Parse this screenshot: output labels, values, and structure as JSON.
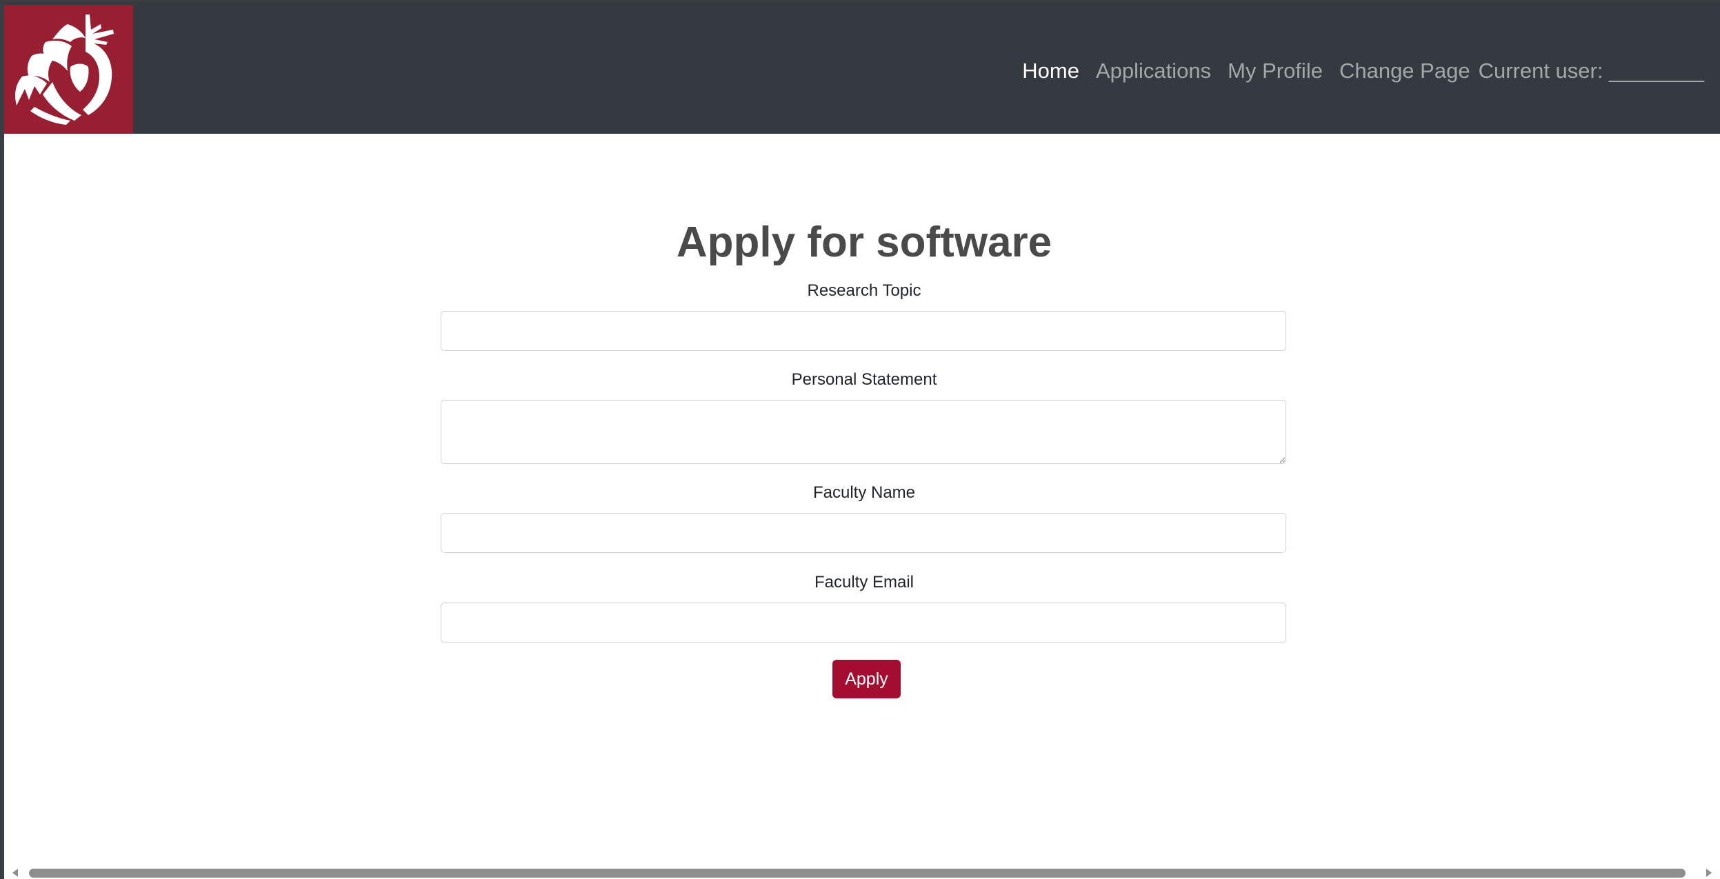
{
  "navbar": {
    "logo": "wsu-cougar-logo",
    "links": [
      {
        "label": "Home",
        "active": true
      },
      {
        "label": "Applications",
        "active": false
      },
      {
        "label": "My Profile",
        "active": false
      },
      {
        "label": "Change Page",
        "active": false
      }
    ],
    "current_user": "Current user: ________"
  },
  "form": {
    "title": "Apply for software",
    "research_topic": {
      "label": "Research Topic",
      "value": ""
    },
    "personal_statement": {
      "label": "Personal Statement",
      "value": ""
    },
    "faculty_name": {
      "label": "Faculty Name",
      "value": ""
    },
    "faculty_email": {
      "label": "Faculty Email",
      "value": ""
    },
    "apply_label": "Apply"
  },
  "colors": {
    "navbar_bg": "#343a40",
    "logo_bg": "#981e32",
    "button_bg": "#a50d30",
    "nav_active": "#ffffff",
    "nav_inactive": "#a4a7aa"
  }
}
